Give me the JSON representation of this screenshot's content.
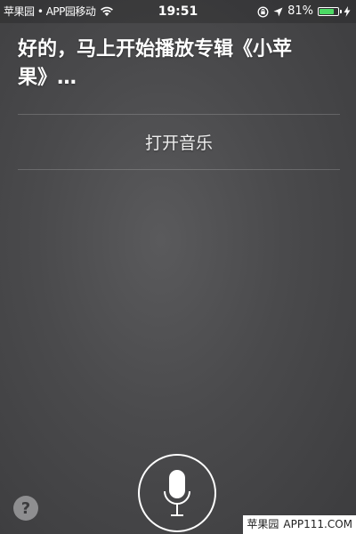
{
  "status_bar": {
    "carrier": "苹果园 • APP园移动",
    "time": "19:51",
    "battery_percent": "81%",
    "battery_level": 0.81
  },
  "siri": {
    "response": "好的，马上开始播放专辑《小苹果》…",
    "action_label": "打开音乐"
  },
  "help": {
    "label": "?"
  },
  "watermark": {
    "name": "苹果园",
    "site": "APP111.COM"
  },
  "colors": {
    "battery": "#4cd964",
    "background": "#4a4a4c"
  }
}
